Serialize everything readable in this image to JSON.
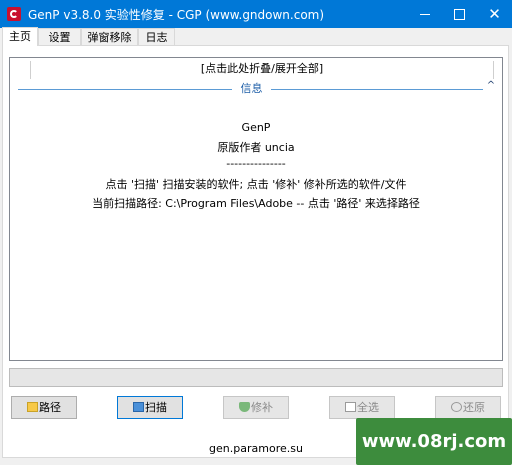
{
  "window": {
    "title": "GenP v3.8.0 实验性修复 - CGP (www.gndown.com)",
    "min_label": "",
    "max_label": "",
    "close_label": "✕"
  },
  "tabs": [
    {
      "label": "主页",
      "active": true
    },
    {
      "label": "设置"
    },
    {
      "label": "弹窗移除"
    },
    {
      "label": "日志"
    }
  ],
  "log": {
    "fold_link": "[点击此处折叠/展开全部]",
    "section_title": "信息",
    "collapse_glyph": "^",
    "lines": [
      "GenP",
      "原版作者 uncia",
      "---------------",
      "点击 '扫描' 扫描安装的软件; 点击 '修补' 修补所选的软件/文件",
      "当前扫描路径: C:\\Program Files\\Adobe -- 点击 '路径' 来选择路径"
    ]
  },
  "progress": {
    "value": 0
  },
  "buttons": {
    "path": "路径",
    "scan": "扫描",
    "patch": "修补",
    "select_all": "全选",
    "restore": "还原"
  },
  "footer": {
    "text": "gen.paramore.su"
  },
  "watermark": {
    "text": "www.08rj.com"
  }
}
